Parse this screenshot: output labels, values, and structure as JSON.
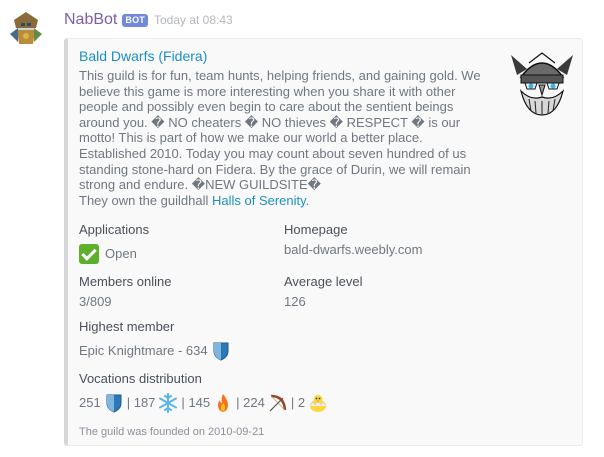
{
  "message": {
    "username": "NabBot",
    "bot_tag": "BOT",
    "timestamp": "Today at 08:43"
  },
  "embed": {
    "title": "Bald Dwarfs (Fidera)",
    "description": "This guild is for fun, team hunts, helping friends, and gaining gold. We believe this game is more interesting when you share it with other people and possibly even begin to care about the sentient beings around you. � NO cheaters � NO thieves � RESPECT � is our motto! This is part of how we make our world a better place. Established 2010. Today you may count about seven hundred of us standing stone-hard on Fidera. By the grace of Durin, we will remain strong and endure. �NEW GUILDSITE�",
    "guildhall_prefix": "They own the guildhall ",
    "guildhall_link": "Halls of Serenity",
    "guildhall_suffix": ".",
    "fields": {
      "applications": {
        "name": "Applications",
        "value": "Open",
        "icon": "check-icon"
      },
      "homepage": {
        "name": "Homepage",
        "value": "bald-dwarfs.weebly.com"
      },
      "members_online": {
        "name": "Members online",
        "value": "3/809"
      },
      "average_level": {
        "name": "Average level",
        "value": "126"
      },
      "highest_member": {
        "name": "Highest member",
        "value": "Epic Knightmare - 634",
        "icon": "shield-icon"
      },
      "vocations": {
        "name": "Vocations distribution",
        "items": [
          {
            "count": "251",
            "icon": "shield-icon"
          },
          {
            "count": "187",
            "icon": "snowflake-icon"
          },
          {
            "count": "145",
            "icon": "fire-icon"
          },
          {
            "count": "224",
            "icon": "bow-icon"
          },
          {
            "count": "2",
            "icon": "chick-icon"
          }
        ],
        "separator": "|"
      }
    },
    "footer": "The guild was founded on 2010-09-21"
  },
  "colors": {
    "username": "#7a5ea8",
    "link": "#1b8fc4",
    "bot_tag": "#7289da",
    "embed_border": "#d6d7d9"
  }
}
